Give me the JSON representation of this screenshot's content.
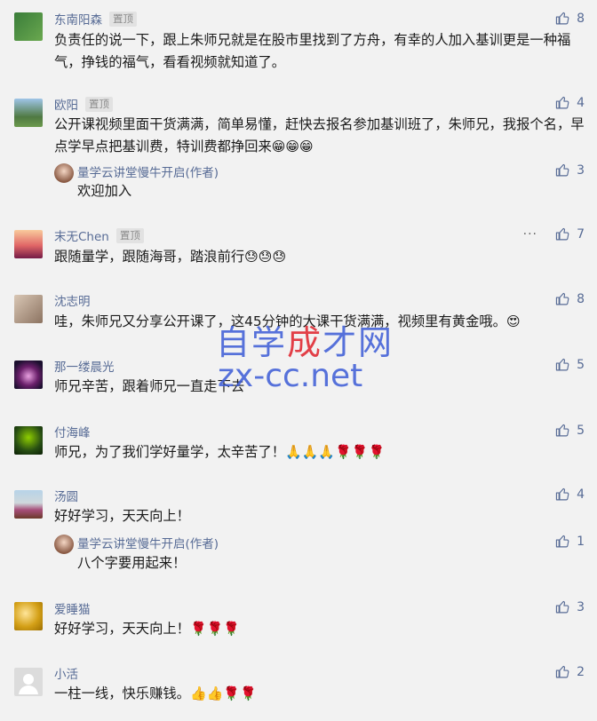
{
  "comments": [
    {
      "name": "东南阳森",
      "pinned": "置顶",
      "likes": "8",
      "text": "负责任的说一下，跟上朱师兄就是在股市里找到了方舟，有幸的人加入基训更是一种福气，挣钱的福气，看看视频就知道了。"
    },
    {
      "name": "欧阳",
      "pinned": "置顶",
      "likes": "4",
      "text": "公开课视频里面干货满满，简单易懂，赶快去报名参加基训班了，朱师兄，我报个名，早点学早点把基训费，特训费都挣回来",
      "reply": {
        "name": "量学云讲堂慢牛开启(作者)",
        "likes": "3",
        "text": "欢迎加入"
      }
    },
    {
      "name": "末无Chen",
      "pinned": "置顶",
      "likes": "7",
      "more": "···",
      "text": "跟随量学，跟随海哥，踏浪前行"
    },
    {
      "name": "沈志明",
      "likes": "8",
      "text": "哇，朱师兄又分享公开课了，这45分钟的大课干货满满，视频里有黄金哦。"
    },
    {
      "name": "那一缕晨光",
      "likes": "5",
      "text": "师兄辛苦，跟着师兄一直走下去"
    },
    {
      "name": "付海峰",
      "likes": "5",
      "text": "师兄，为了我们学好量学，太辛苦了！"
    },
    {
      "name": "汤圆",
      "likes": "4",
      "text": "好好学习，天天向上！",
      "reply": {
        "name": "量学云讲堂慢牛开启(作者)",
        "likes": "1",
        "text": "八个字要用起来！"
      }
    },
    {
      "name": "爱睡猫",
      "likes": "3",
      "text": "好好学习，天天向上！"
    },
    {
      "name": "小活",
      "likes": "2",
      "text": "一柱一线，快乐赚钱。"
    }
  ],
  "watermark": {
    "zh_part1": "自学",
    "zh_part2": "成",
    "zh_part3": "才网",
    "en": "zx-cc.net"
  },
  "colors": {
    "name": "#576b95",
    "background": "#f2f2f2",
    "watermark_blue": "#3b5bd6",
    "watermark_red": "#e0202a"
  }
}
